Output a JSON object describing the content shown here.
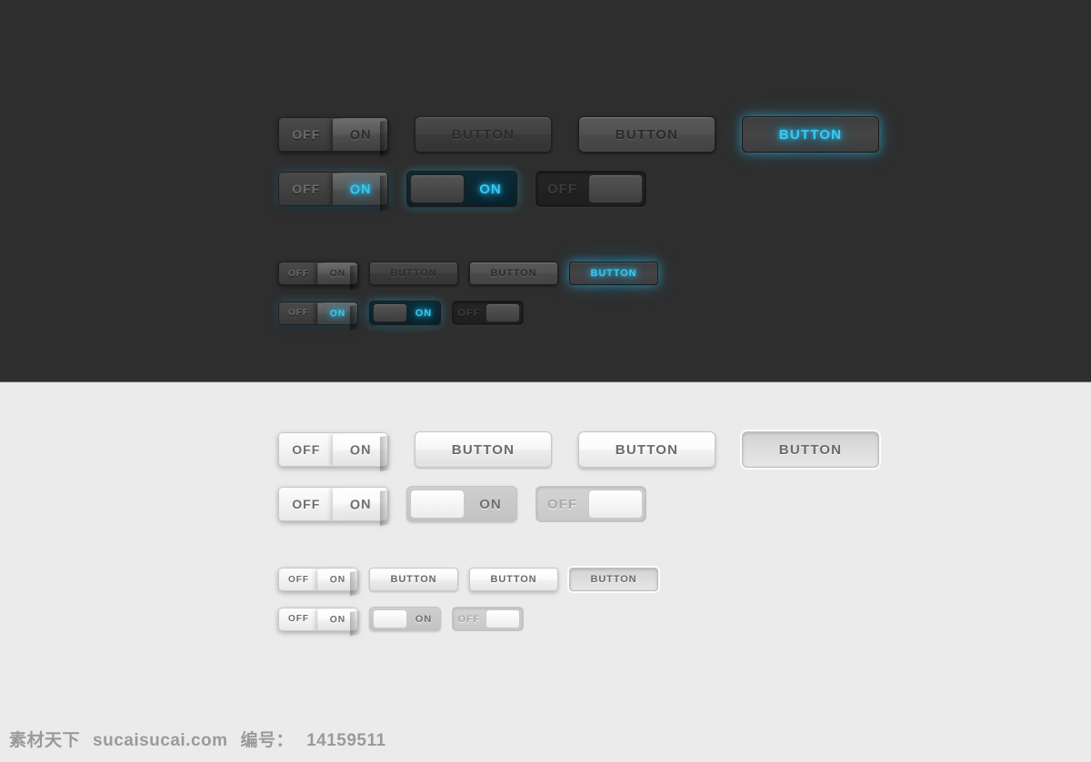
{
  "page": {
    "background_dark": "#2e2e2e",
    "background_light": "#ebebeb",
    "accent_glow": "#35c8f0"
  },
  "labels": {
    "off": "OFF",
    "on": "ON",
    "button": "BUTTON"
  },
  "dark_section": {
    "large_row_1": [
      {
        "name": "toggle-peel-off",
        "type": "peel-toggle",
        "left": "OFF",
        "right": "ON",
        "state": "default"
      },
      {
        "name": "button-normal",
        "type": "button",
        "label": "BUTTON",
        "state": "normal"
      },
      {
        "name": "button-hover",
        "type": "button",
        "label": "BUTTON",
        "state": "hover"
      },
      {
        "name": "button-active",
        "type": "button",
        "label": "BUTTON",
        "state": "active"
      }
    ],
    "large_row_2": [
      {
        "name": "toggle-peel-on",
        "type": "peel-toggle",
        "left": "OFF",
        "right": "ON",
        "state": "glow"
      },
      {
        "name": "slider-on",
        "type": "slider",
        "label": "ON",
        "state": "on"
      },
      {
        "name": "slider-off",
        "type": "slider",
        "label": "OFF",
        "state": "off"
      }
    ],
    "small_row_1": [
      {
        "name": "toggle-peel-off-small",
        "type": "peel-toggle",
        "left": "OFF",
        "right": "ON",
        "state": "default"
      },
      {
        "name": "button-normal-small",
        "type": "button",
        "label": "BUTTON",
        "state": "normal"
      },
      {
        "name": "button-hover-small",
        "type": "button",
        "label": "BUTTON",
        "state": "hover"
      },
      {
        "name": "button-active-small",
        "type": "button",
        "label": "BUTTON",
        "state": "active"
      }
    ],
    "small_row_2": [
      {
        "name": "toggle-peel-on-small",
        "type": "peel-toggle",
        "left": "OFF",
        "right": "ON",
        "state": "glow"
      },
      {
        "name": "slider-on-small",
        "type": "slider",
        "label": "ON",
        "state": "on"
      },
      {
        "name": "slider-off-small",
        "type": "slider",
        "label": "OFF",
        "state": "off"
      }
    ]
  },
  "light_section": {
    "large_row_1": [
      {
        "name": "toggle-peel-off",
        "type": "peel-toggle",
        "left": "OFF",
        "right": "ON",
        "state": "default"
      },
      {
        "name": "button-normal",
        "type": "button",
        "label": "BUTTON",
        "state": "normal"
      },
      {
        "name": "button-hover",
        "type": "button",
        "label": "BUTTON",
        "state": "hover"
      },
      {
        "name": "button-active",
        "type": "button",
        "label": "BUTTON",
        "state": "active"
      }
    ],
    "large_row_2": [
      {
        "name": "toggle-peel-on",
        "type": "peel-toggle",
        "left": "OFF",
        "right": "ON",
        "state": "default"
      },
      {
        "name": "slider-on",
        "type": "slider",
        "label": "ON",
        "state": "on"
      },
      {
        "name": "slider-off",
        "type": "slider",
        "label": "OFF",
        "state": "off"
      }
    ],
    "small_row_1": [
      {
        "name": "toggle-peel-off-small",
        "type": "peel-toggle",
        "left": "OFF",
        "right": "ON",
        "state": "default"
      },
      {
        "name": "button-normal-small",
        "type": "button",
        "label": "BUTTON",
        "state": "normal"
      },
      {
        "name": "button-hover-small",
        "type": "button",
        "label": "BUTTON",
        "state": "hover"
      },
      {
        "name": "button-active-small",
        "type": "button",
        "label": "BUTTON",
        "state": "active"
      }
    ],
    "small_row_2": [
      {
        "name": "toggle-peel-on-small",
        "type": "peel-toggle",
        "left": "OFF",
        "right": "ON",
        "state": "default"
      },
      {
        "name": "slider-on-small",
        "type": "slider",
        "label": "ON",
        "state": "on"
      },
      {
        "name": "slider-off-small",
        "type": "slider",
        "label": "OFF",
        "state": "off"
      }
    ]
  },
  "footer": {
    "site_name": "素材天下",
    "domain": "sucaisucai.com",
    "id_label": "编号：",
    "id_number": "14159511"
  }
}
